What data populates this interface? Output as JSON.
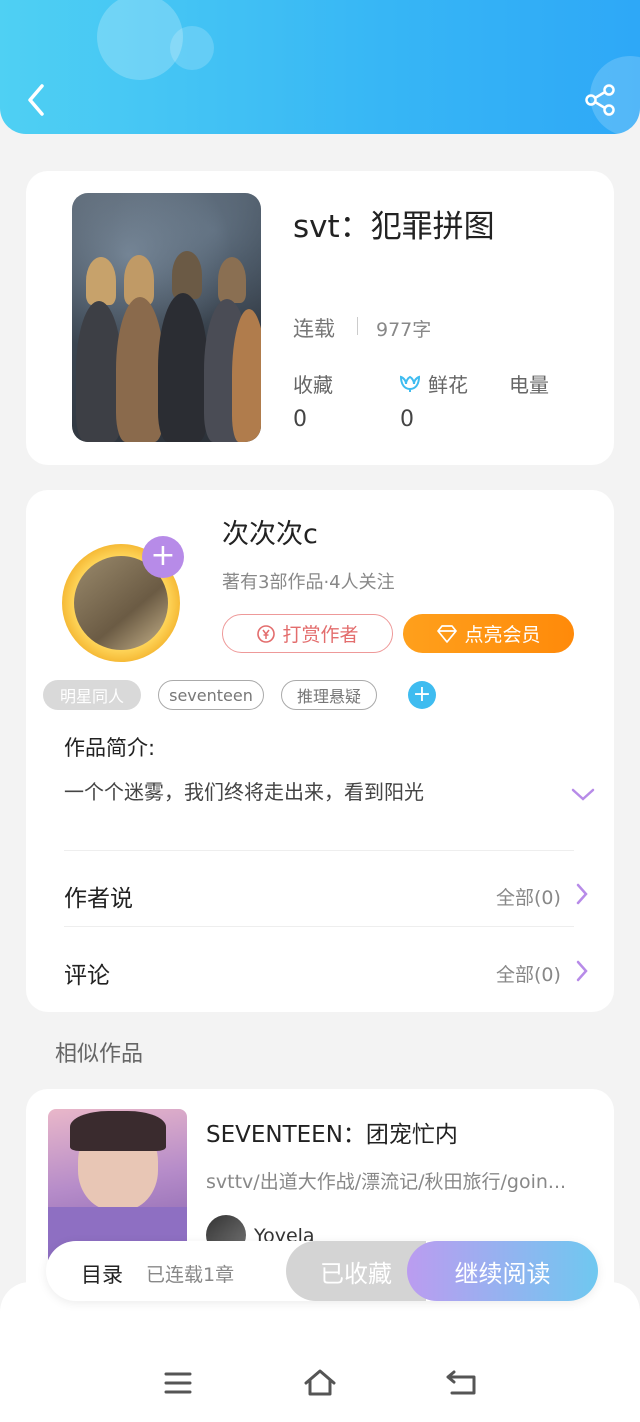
{
  "header": {
    "back_icon": "back-chevron-icon",
    "share_icon": "share-icon"
  },
  "book": {
    "title": "svt：犯罪拼图",
    "status": "连载",
    "word_count": "977字",
    "stats": [
      {
        "label": "收藏",
        "value": "0"
      },
      {
        "label": "鲜花",
        "value": "0",
        "icon": "flower-icon"
      },
      {
        "label": "电量",
        "value": ""
      }
    ]
  },
  "author": {
    "name": "次次次c",
    "meta": "著有3部作品·4人关注",
    "tip_button": "打赏作者",
    "vip_button": "点亮会员",
    "tags": [
      "明星同人",
      "seventeen",
      "推理悬疑"
    ],
    "intro_label": "作品简介:",
    "intro_text": "一个个迷雾，我们终将走出来，看到阳光",
    "rows": [
      {
        "label": "作者说",
        "value": "全部(0)"
      },
      {
        "label": "评论",
        "value": "全部(0)"
      }
    ]
  },
  "similar": {
    "section_title": "相似作品",
    "items": [
      {
        "title": "SEVENTEEN：团宠忙内",
        "tags": "svttv/出道大作战/漂流记/秋田旅行/goin...",
        "author": "Yoyela"
      }
    ]
  },
  "bottom_bar": {
    "toc": "目录",
    "chapters": "已连载1章",
    "saved": "已收藏",
    "read": "继续阅读"
  },
  "colors": {
    "header": "#37b6f5",
    "vip": "#ff8a0a",
    "tip": "#e36d6d",
    "accent": "#b78be8"
  }
}
